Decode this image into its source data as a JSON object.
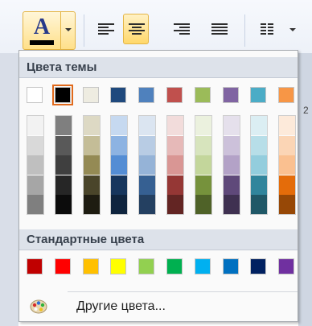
{
  "toolbar": {
    "font_color_letter": "A",
    "font_color_accent": "#000000",
    "buttons": [
      {
        "name": "align-left",
        "active": false
      },
      {
        "name": "align-center",
        "active": true
      },
      {
        "name": "align-right",
        "active": false
      },
      {
        "name": "justify",
        "active": false
      },
      {
        "name": "columns",
        "active": false
      }
    ]
  },
  "ruler": {
    "number": "2"
  },
  "dropdown": {
    "theme_header": "Цвета темы",
    "standard_header": "Стандартные цвета",
    "more_colors_label": "Другие цвета...",
    "selected_theme_index": 1,
    "theme_colors": [
      "#ffffff",
      "#000000",
      "#eeece1",
      "#1f497d",
      "#4f81bd",
      "#c0504d",
      "#9bbb59",
      "#8064a2",
      "#4bacc6",
      "#f79646"
    ],
    "theme_shades": [
      [
        "#f2f2f2",
        "#d9d9d9",
        "#bfbfbf",
        "#a6a6a6",
        "#7f7f7f"
      ],
      [
        "#7f7f7f",
        "#595959",
        "#3f3f3f",
        "#262626",
        "#0c0c0c"
      ],
      [
        "#ddd9c4",
        "#c4bd97",
        "#948a54",
        "#4a452a",
        "#1e1c11"
      ],
      [
        "#c6d9f0",
        "#8db3e2",
        "#548dd4",
        "#17365d",
        "#0f243e"
      ],
      [
        "#dbe5f1",
        "#b8cce4",
        "#95b3d7",
        "#366092",
        "#244061"
      ],
      [
        "#f2dcdb",
        "#e6b9b8",
        "#d99694",
        "#953735",
        "#632523"
      ],
      [
        "#ebf1de",
        "#d7e4bd",
        "#c3d69b",
        "#76923c",
        "#4f6228"
      ],
      [
        "#e5e0ec",
        "#ccc1da",
        "#b3a2c7",
        "#5f497a",
        "#3f3151"
      ],
      [
        "#dbeef3",
        "#b7dee8",
        "#93cddd",
        "#31859c",
        "#205867"
      ],
      [
        "#fdeada",
        "#fbd5b5",
        "#fac090",
        "#e46c0a",
        "#974806"
      ]
    ],
    "standard_colors": [
      "#c00000",
      "#ff0000",
      "#ffc000",
      "#ffff00",
      "#92d050",
      "#00b050",
      "#00b0f0",
      "#0070c0",
      "#002060",
      "#7030a0"
    ]
  }
}
